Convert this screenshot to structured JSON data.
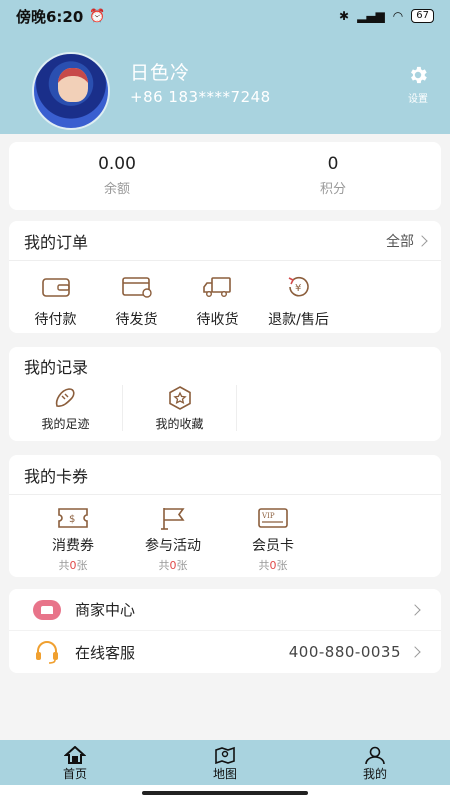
{
  "status": {
    "time": "傍晚6:20",
    "battery": "67"
  },
  "profile": {
    "name": "日色冷",
    "phone": "+86 183****7248",
    "settings_label": "设置"
  },
  "balance": {
    "amount": "0.00",
    "amount_label": "余额",
    "points": "0",
    "points_label": "积分"
  },
  "orders": {
    "title": "我的订单",
    "all_label": "全部",
    "items": [
      {
        "label": "待付款",
        "icon": "wallet-icon"
      },
      {
        "label": "待发货",
        "icon": "card-icon"
      },
      {
        "label": "待收货",
        "icon": "truck-icon"
      },
      {
        "label": "退款/售后",
        "icon": "refund-icon"
      }
    ]
  },
  "records": {
    "title": "我的记录",
    "items": [
      {
        "label": "我的足迹",
        "icon": "footprint-icon"
      },
      {
        "label": "我的收藏",
        "icon": "star-icon"
      }
    ]
  },
  "coupons": {
    "title": "我的卡券",
    "count_prefix": "共",
    "count_suffix": "张",
    "items": [
      {
        "label": "消费券",
        "count": "0",
        "icon": "coupon-icon"
      },
      {
        "label": "参与活动",
        "count": "0",
        "icon": "flag-icon"
      },
      {
        "label": "会员卡",
        "count": "0",
        "icon": "vip-card-icon"
      }
    ]
  },
  "services": {
    "merchant_label": "商家中心",
    "support_label": "在线客服",
    "support_phone": "400-880-0035"
  },
  "tabbar": {
    "home": "首页",
    "map": "地图",
    "mine": "我的"
  },
  "colors": {
    "header": "#a9d3df",
    "accent": "#8b5e3c",
    "badge": "#e04a4a"
  }
}
